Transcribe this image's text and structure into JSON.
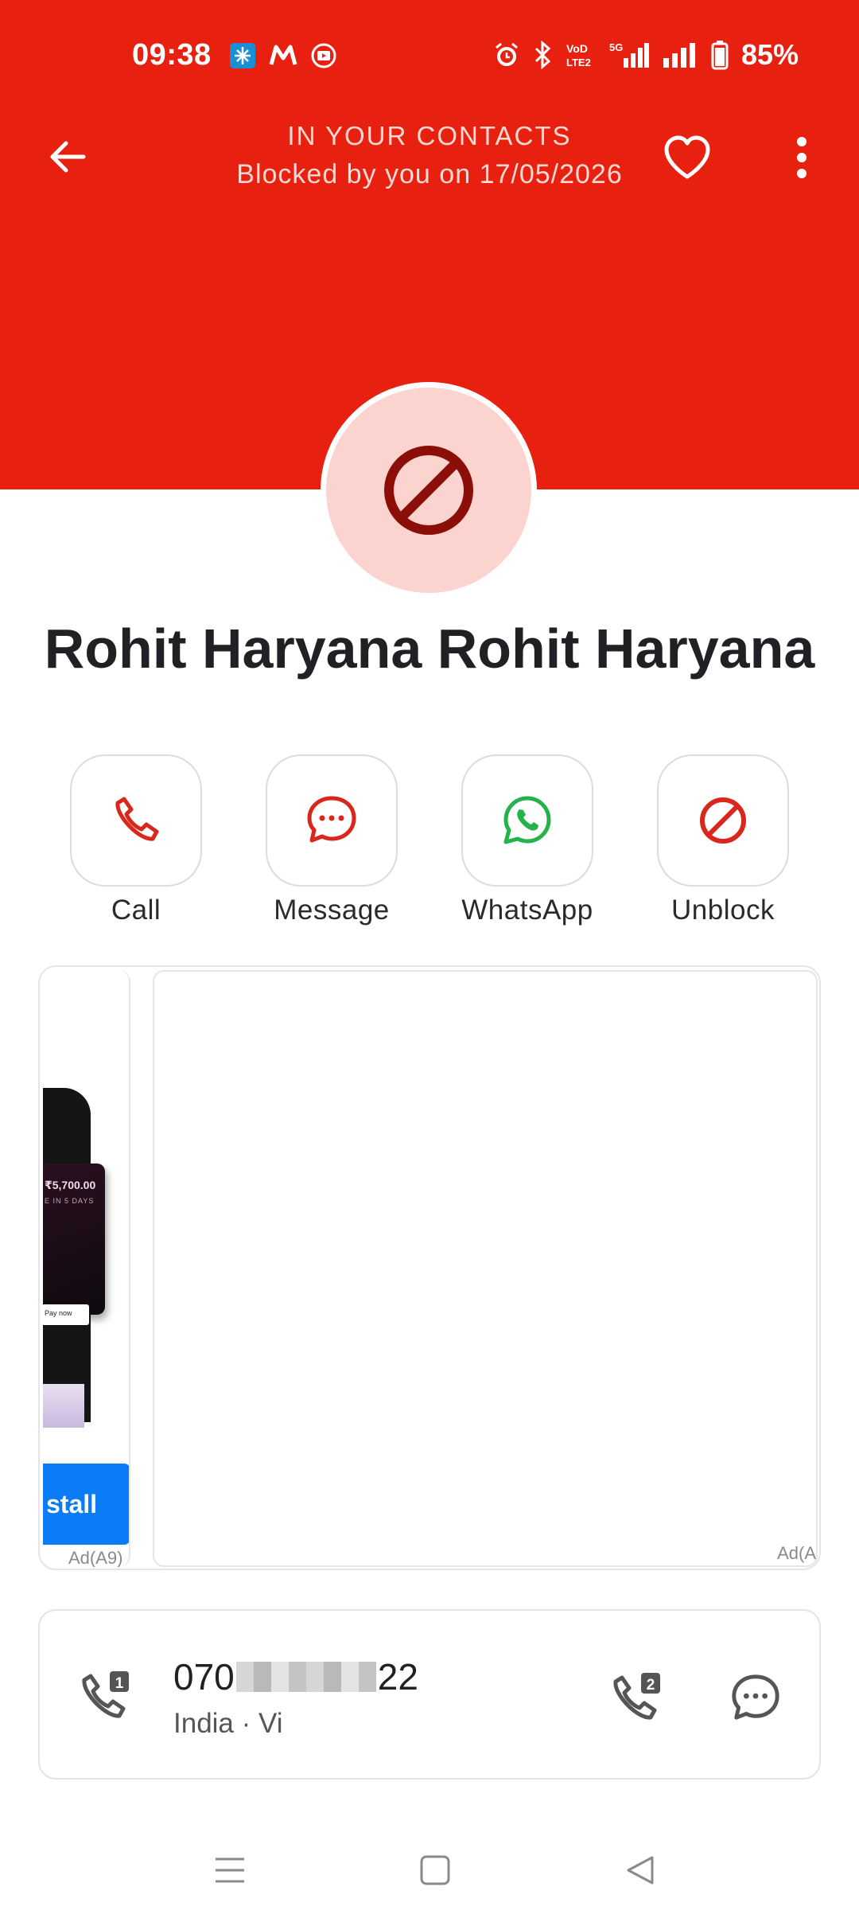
{
  "status_bar": {
    "time": "09:38",
    "battery": "85%",
    "network": "5G",
    "volte": "VoLTE2"
  },
  "header": {
    "subtitle_top": "IN YOUR CONTACTS",
    "subtitle": "Blocked by you on 17/05/2026"
  },
  "contact": {
    "name": "Rohit Haryana Rohit Haryana"
  },
  "actions": [
    {
      "label": "Call",
      "icon": "phone-icon",
      "color": "#d9271c"
    },
    {
      "label": "Message",
      "icon": "message-icon",
      "color": "#d9271c"
    },
    {
      "label": "WhatsApp",
      "icon": "whatsapp-icon",
      "color": "#25b24a"
    },
    {
      "label": "Unblock",
      "icon": "block-icon",
      "color": "#d9271c"
    }
  ],
  "ads": {
    "left_amount": "₹5,700.00",
    "left_small": "E IN 5 DAYS",
    "left_paynow": "Pay now",
    "left_install": "stall",
    "left_label": "Ad(A9)",
    "right_label": "Ad(A"
  },
  "phone": {
    "number_prefix": "070",
    "number_suffix": "22",
    "meta": "India · Vi"
  },
  "colors": {
    "header_red": "#e8200f",
    "avatar_bg": "#fbd3cf",
    "accent_red": "#d9271c",
    "whatsapp_green": "#25b24a"
  }
}
